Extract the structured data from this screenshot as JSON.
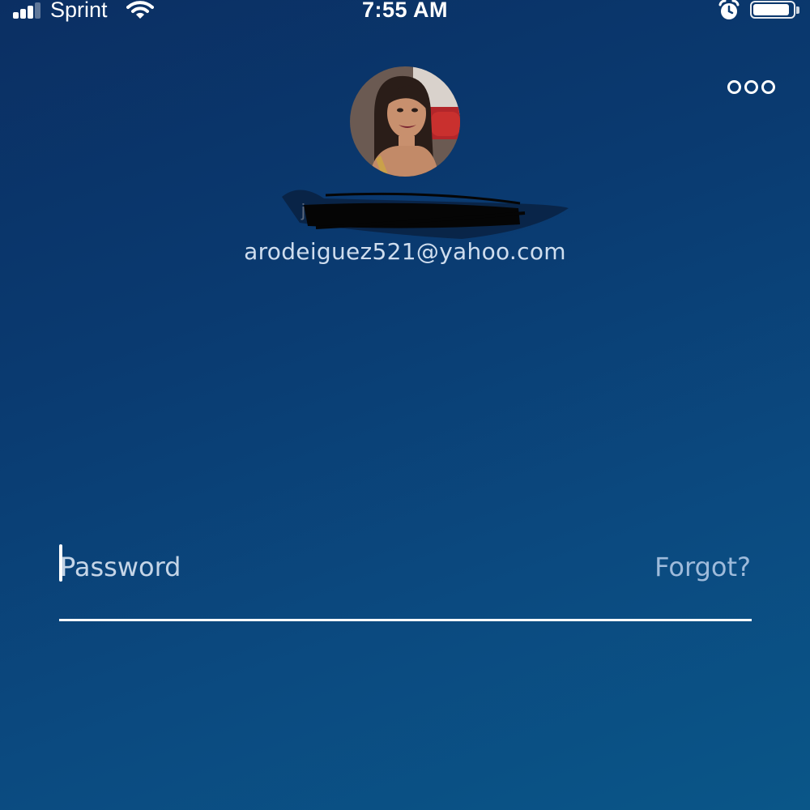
{
  "status_bar": {
    "carrier": "Sprint",
    "time": "7:55 AM",
    "signal_bars_filled": 3,
    "signal_bars_total": 4,
    "battery_level": 0.92,
    "icons": [
      "signal-icon",
      "wifi-icon",
      "alarm-icon",
      "battery-icon"
    ]
  },
  "header": {
    "menu_icon": "more-horizontal-icon"
  },
  "profile": {
    "avatar": "profile-photo",
    "name_redacted": true,
    "name_visible_text": "je",
    "email": "arodeiguez521@yahoo.com"
  },
  "login": {
    "password_placeholder": "Password",
    "password_value": "",
    "forgot_label": "Forgot?"
  },
  "colors": {
    "background_top": "#0b2f63",
    "background_bottom": "#0a5688",
    "text": "#ffffff",
    "forgot_link": "#afc8e4"
  }
}
